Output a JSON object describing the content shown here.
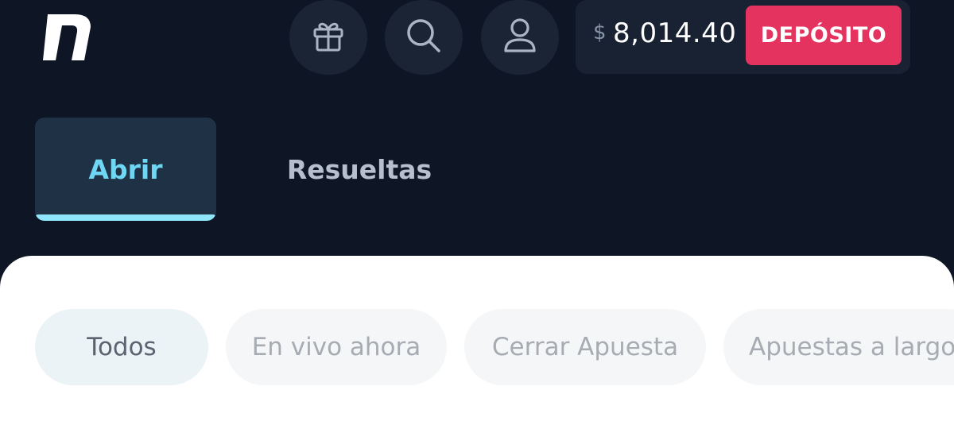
{
  "header": {
    "logo_icon": "n-logo-icon",
    "icons": [
      "gift-icon",
      "search-icon",
      "user-icon"
    ],
    "balance": {
      "currency_symbol": "$",
      "amount": "8,014.40"
    },
    "deposit_label": "DEPÓSITO",
    "colors": {
      "background": "#0e1525",
      "icon_circle": "#1a2435",
      "deposit": "#e53360"
    }
  },
  "tabs": [
    {
      "label": "Abrir",
      "active": true
    },
    {
      "label": "Resueltas",
      "active": false
    }
  ],
  "filters": [
    {
      "label": "Todos",
      "active": true
    },
    {
      "label": "En vivo ahora",
      "active": false
    },
    {
      "label": "Cerrar Apuesta",
      "active": false
    },
    {
      "label": "Apuestas a largo",
      "active": false
    }
  ],
  "accent_color": "#6fd6f3"
}
